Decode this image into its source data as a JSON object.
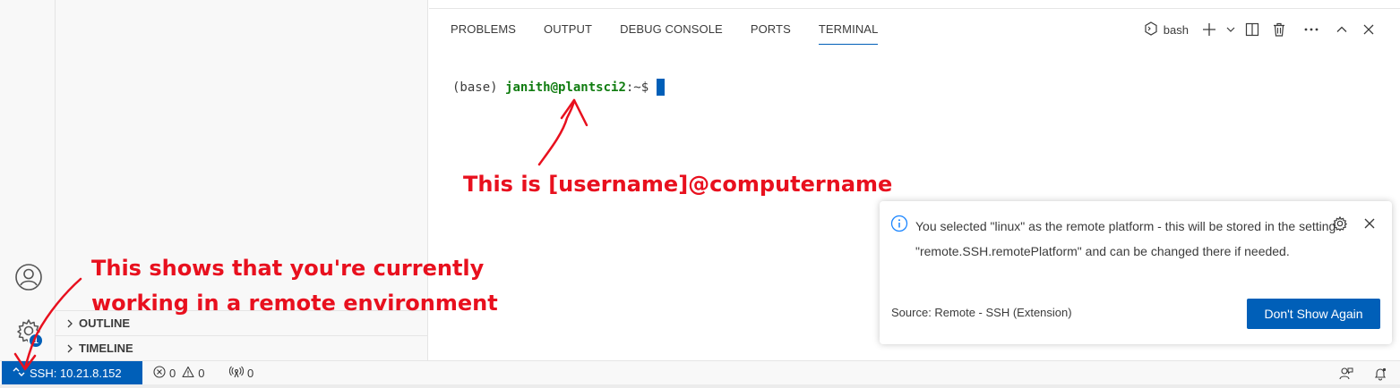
{
  "activity_bar": {
    "account_icon": "account-icon",
    "manage_icon": "gear-icon",
    "manage_badge": "1"
  },
  "sidebar": {
    "sections": [
      {
        "label": "OUTLINE",
        "icon": "chevron-right-icon"
      },
      {
        "label": "TIMELINE",
        "icon": "chevron-right-icon"
      }
    ]
  },
  "panel": {
    "tabs": [
      "PROBLEMS",
      "OUTPUT",
      "DEBUG CONSOLE",
      "PORTS",
      "TERMINAL"
    ],
    "active_tab": "TERMINAL",
    "shell": "bash",
    "actions": [
      "terminal-icon",
      "plus-icon",
      "chevron-down-icon",
      "split-icon",
      "trash-icon",
      "more-icon",
      "chevron-up-icon",
      "close-icon"
    ]
  },
  "terminal": {
    "prefix": "(base) ",
    "user_host": "janith@plantsci2",
    "path_prompt": ":~$"
  },
  "notification": {
    "icon": "info-icon",
    "message": "You selected \"linux\" as the remote platform - this will be stored in the setting \"remote.SSH.remotePlatform\" and can be changed there if needed.",
    "source": "Source: Remote - SSH (Extension)",
    "button_label": "Don't Show Again"
  },
  "statusbar": {
    "remote_label": "SSH: 10.21.8.152",
    "errors": "0",
    "warnings": "0",
    "ports": "0"
  },
  "annotations": {
    "username_note": "This is [username]@computername",
    "remote_note_line1": "This shows that you're currently",
    "remote_note_line2": "working in a remote environment"
  },
  "colors": {
    "accent": "#005fb8",
    "annotation": "#e8101e",
    "prompt_green": "#107c10"
  }
}
